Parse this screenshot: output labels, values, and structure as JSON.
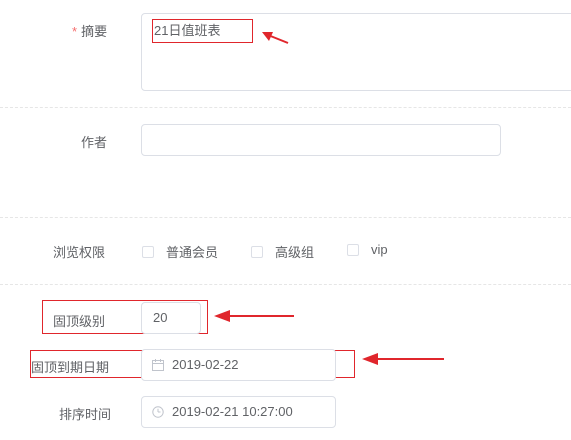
{
  "summary": {
    "label": "摘要",
    "required_mark": "*",
    "value": "21日值班表"
  },
  "author": {
    "label": "作者",
    "value": ""
  },
  "browse_permission": {
    "label": "浏览权限",
    "options": [
      {
        "label": "普通会员",
        "checked": false
      },
      {
        "label": "高级组",
        "checked": false
      },
      {
        "label": "vip",
        "checked": false
      }
    ]
  },
  "pin_level": {
    "label": "固顶级别",
    "value": "20"
  },
  "pin_expiry": {
    "label": "固顶到期日期",
    "value": "2019-02-22",
    "icon": "calendar-icon"
  },
  "sort_time": {
    "label": "排序时间",
    "value": "2019-02-21 10:27:00",
    "icon": "clock-icon"
  },
  "colors": {
    "annotation_red": "#e0262c",
    "border": "#dcdfe6",
    "text": "#606266",
    "required": "#f56c6c"
  }
}
